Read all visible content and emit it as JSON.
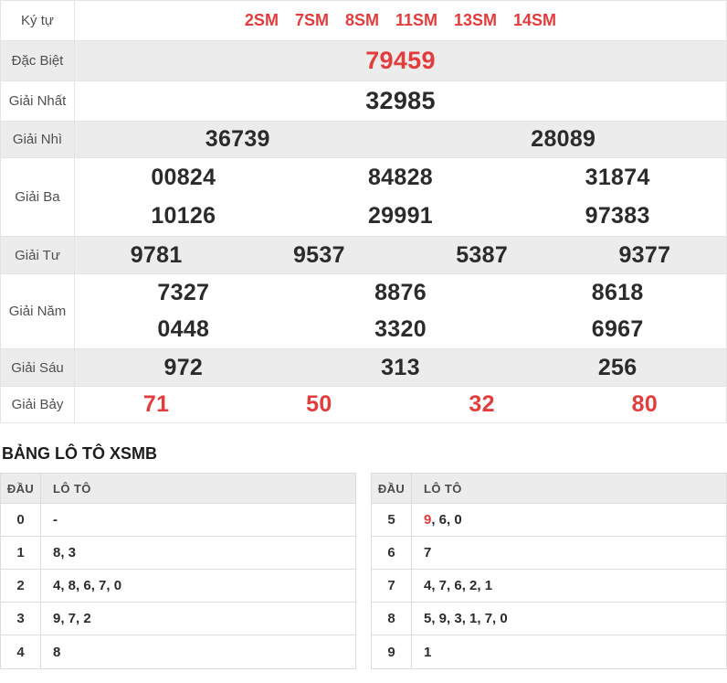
{
  "colors": {
    "accent_red": "#e23c3c",
    "stripe_bg": "#ececec",
    "border": "#e3e3e3",
    "number_dark": "#2b2b2b"
  },
  "results": {
    "rows": [
      {
        "label": "Ký tự",
        "codes": [
          "2SM",
          "7SM",
          "8SM",
          "11SM",
          "13SM",
          "14SM"
        ]
      },
      {
        "label": "Đặc Biệt",
        "values": [
          "79459"
        ]
      },
      {
        "label": "Giải Nhất",
        "values": [
          "32985"
        ]
      },
      {
        "label": "Giải Nhì",
        "values": [
          "36739",
          "28089"
        ]
      },
      {
        "label": "Giải Ba",
        "values": [
          "00824",
          "84828",
          "31874",
          "10126",
          "29991",
          "97383"
        ]
      },
      {
        "label": "Giải Tư",
        "values": [
          "9781",
          "9537",
          "5387",
          "9377"
        ]
      },
      {
        "label": "Giải Năm",
        "values": [
          "7327",
          "8876",
          "8618",
          "0448",
          "3320",
          "6967"
        ]
      },
      {
        "label": "Giải Sáu",
        "values": [
          "972",
          "313",
          "256"
        ]
      },
      {
        "label": "Giải Bảy",
        "values": [
          "71",
          "50",
          "32",
          "80"
        ]
      }
    ]
  },
  "loto": {
    "title": "BẢNG LÔ TÔ XSMB",
    "columns": {
      "dau": "ĐẦU",
      "loto": "LÔ TÔ"
    },
    "left_rows": [
      {
        "dau": "0",
        "value": "-"
      },
      {
        "dau": "1",
        "value": "8, 3"
      },
      {
        "dau": "2",
        "value": "4, 8, 6, 7, 0"
      },
      {
        "dau": "3",
        "value": "9, 7, 2"
      },
      {
        "dau": "4",
        "value": "8"
      }
    ],
    "right_rows": [
      {
        "dau": "5",
        "highlight": "9",
        "value": ", 6, 0"
      },
      {
        "dau": "6",
        "value": "7"
      },
      {
        "dau": "7",
        "value": "4, 7, 6, 2, 1"
      },
      {
        "dau": "8",
        "value": "5, 9, 3, 1, 7, 0"
      },
      {
        "dau": "9",
        "value": "1"
      }
    ]
  }
}
